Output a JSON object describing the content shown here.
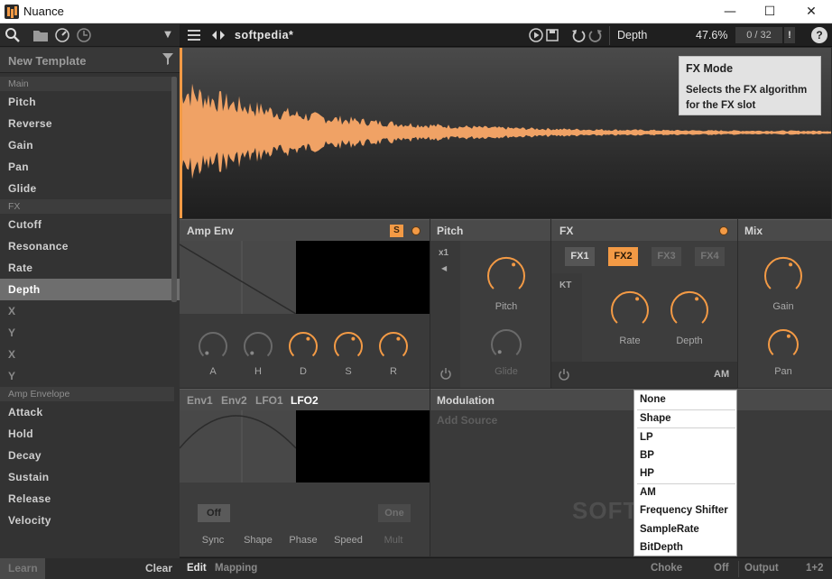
{
  "window": {
    "title": "Nuance",
    "minimize": "—",
    "maximize": "☐",
    "close": "✕"
  },
  "sidebar": {
    "template_label": "New Template",
    "sections": [
      {
        "label": "Main",
        "items": [
          "Pitch",
          "Reverse",
          "Gain",
          "Pan",
          "Glide"
        ]
      },
      {
        "label": "FX",
        "items": [
          "Cutoff",
          "Resonance",
          "Rate",
          "Depth",
          "X",
          "Y",
          "X",
          "Y"
        ]
      },
      {
        "label": "Amp Envelope",
        "items": [
          "Attack",
          "Hold",
          "Decay",
          "Sustain",
          "Release",
          "Velocity"
        ]
      }
    ],
    "selected_item": "Depth",
    "learn_label": "Learn",
    "clear_label": "Clear"
  },
  "topbar": {
    "preset_name": "softpedia*",
    "param_name": "Depth",
    "param_value": "47.6%",
    "counter": "0 / 32",
    "warning": "!",
    "help": "?"
  },
  "tooltip": {
    "title": "FX Mode",
    "body": "Selects the FX algorithm for the FX slot"
  },
  "amp_env": {
    "title": "Amp Env",
    "solo": "S",
    "knobs": [
      "A",
      "H",
      "D",
      "S",
      "R"
    ]
  },
  "pitch": {
    "title": "Pitch",
    "multiplier": "x1",
    "knobs": [
      "Pitch",
      "Glide"
    ]
  },
  "fx": {
    "title": "FX",
    "slots": [
      "FX1",
      "FX2",
      "FX3",
      "FX4"
    ],
    "active_slot": "FX2",
    "kt": "KT",
    "knobs": [
      "Rate",
      "Depth"
    ],
    "mode": "AM"
  },
  "mix": {
    "title": "Mix",
    "knobs": [
      "Gain",
      "Pan"
    ]
  },
  "lfo": {
    "tabs": [
      "Env1",
      "Env2",
      "LFO1",
      "LFO2"
    ],
    "active_tab": "LFO2",
    "sync": "Off",
    "mult": "One",
    "labels": [
      "Sync",
      "Shape",
      "Phase",
      "Speed",
      "Mult"
    ]
  },
  "modulation": {
    "title": "Modulation",
    "add_source": "Add Source"
  },
  "dropdown": [
    "None",
    "Shape",
    "LP",
    "BP",
    "HP",
    "AM",
    "Frequency Shifter",
    "SampleRate",
    "BitDepth"
  ],
  "bottombar": {
    "edit": "Edit",
    "mapping": "Mapping",
    "choke": "Choke",
    "choke_value": "Off",
    "output": "Output",
    "output_value": "1+2"
  },
  "watermark": "SOFTPEDIA",
  "colors": {
    "accent": "#f39a45",
    "panel": "#3d3d3d",
    "background": "#2b2b2b"
  }
}
